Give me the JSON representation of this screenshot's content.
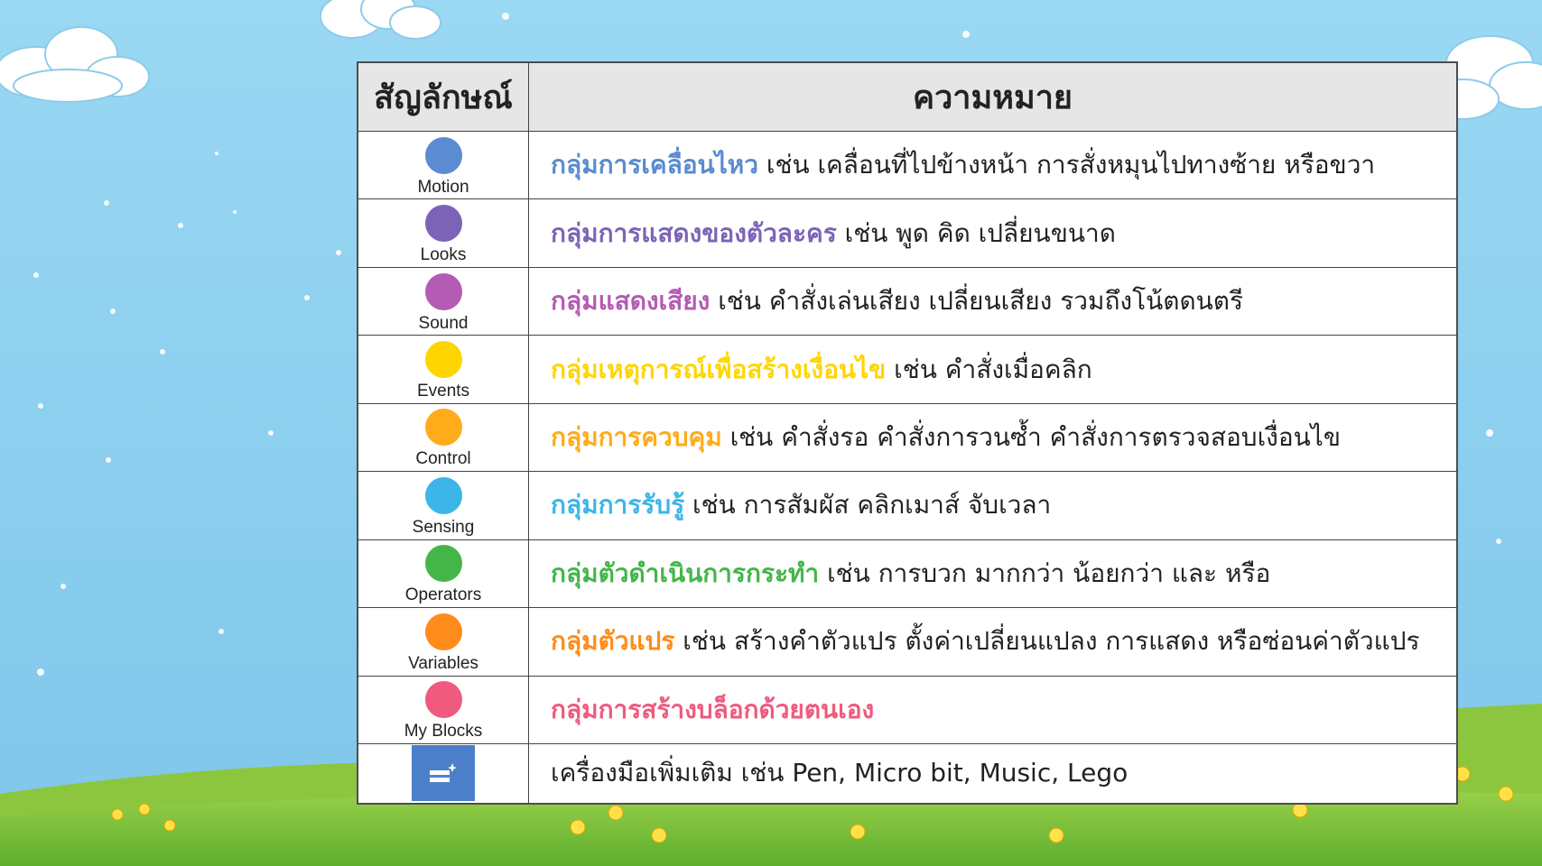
{
  "header": {
    "symbol": "สัญลักษณ์",
    "meaning": "ความหมาย"
  },
  "rows": [
    {
      "label": "Motion",
      "color": "#5b8bd0",
      "name": "กลุ่มการเคลื่อนไหว",
      "rest": " เช่น เคลื่อนที่ไปข้างหน้า การสั่งหมุนไปทางซ้าย หรือขวา"
    },
    {
      "label": "Looks",
      "color": "#7d63b8",
      "name": "กลุ่มการแสดงของตัวละคร",
      "rest": " เช่น พูด คิด เปลี่ยนขนาด"
    },
    {
      "label": "Sound",
      "color": "#b45bb4",
      "name": "กลุ่มแสดงเสียง",
      "rest": " เช่น คำสั่งเล่นเสียง เปลี่ยนเสียง รวมถึงโน้ตดนตรี"
    },
    {
      "label": "Events",
      "color": "#ffd500",
      "name": "กลุ่มเหตุการณ์เพื่อสร้างเงื่อนไข",
      "rest": " เช่น คำสั่งเมื่อคลิก"
    },
    {
      "label": "Control",
      "color": "#ffab1a",
      "name": "กลุ่มการควบคุม",
      "rest": " เช่น คำสั่งรอ คำสั่งการวนซ้ำ คำสั่งการตรวจสอบเงื่อนไข"
    },
    {
      "label": "Sensing",
      "color": "#3cb6e8",
      "name": "กลุ่มการรับรู้",
      "rest": " เช่น การสัมผัส คลิกเมาส์ จับเวลา"
    },
    {
      "label": "Operators",
      "color": "#44b649",
      "name": "กลุ่มตัวดำเนินการกระทำ",
      "rest": " เช่น การบวก มากกว่า น้อยกว่า และ หรือ"
    },
    {
      "label": "Variables",
      "color": "#ff8c1a",
      "name": "กลุ่มตัวแปร",
      "rest": " เช่น สร้างคำตัวแปร ตั้งค่าเปลี่ยนแปลง การแสดง หรือซ่อนค่าตัวแปร"
    },
    {
      "label": "My Blocks",
      "color": "#ef5a7e",
      "name": "กลุ่มการสร้างบล็อกด้วยตนเอง",
      "rest": ""
    }
  ],
  "extension": {
    "icon": "extension-icon",
    "text": "เครื่องมือเพิ่มเติม เช่น Pen, Micro bit, Music, Lego"
  },
  "colors": {
    "sky": "#8fd0ef",
    "grass": "#7cc03a",
    "header_bg": "#e6e6e6",
    "extension_icon_bg": "#4c7fc9"
  }
}
